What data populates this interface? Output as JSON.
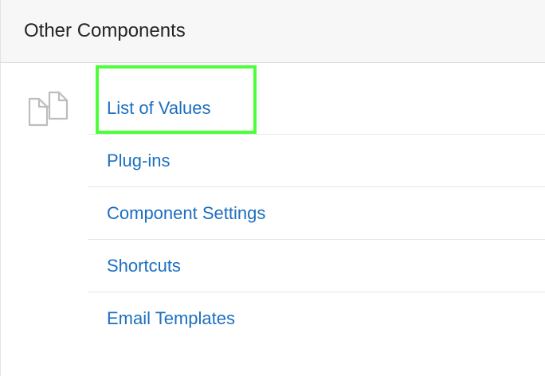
{
  "panel": {
    "title": "Other Components",
    "icon": "documents-icon"
  },
  "links": [
    {
      "label": "List of Values"
    },
    {
      "label": "Plug-ins"
    },
    {
      "label": "Component Settings"
    },
    {
      "label": "Shortcuts"
    },
    {
      "label": "Email Templates"
    }
  ],
  "colors": {
    "link": "#1c6fbf",
    "highlight": "#4dff3a",
    "header_bg": "#f7f7f7",
    "title_text": "#262626"
  }
}
